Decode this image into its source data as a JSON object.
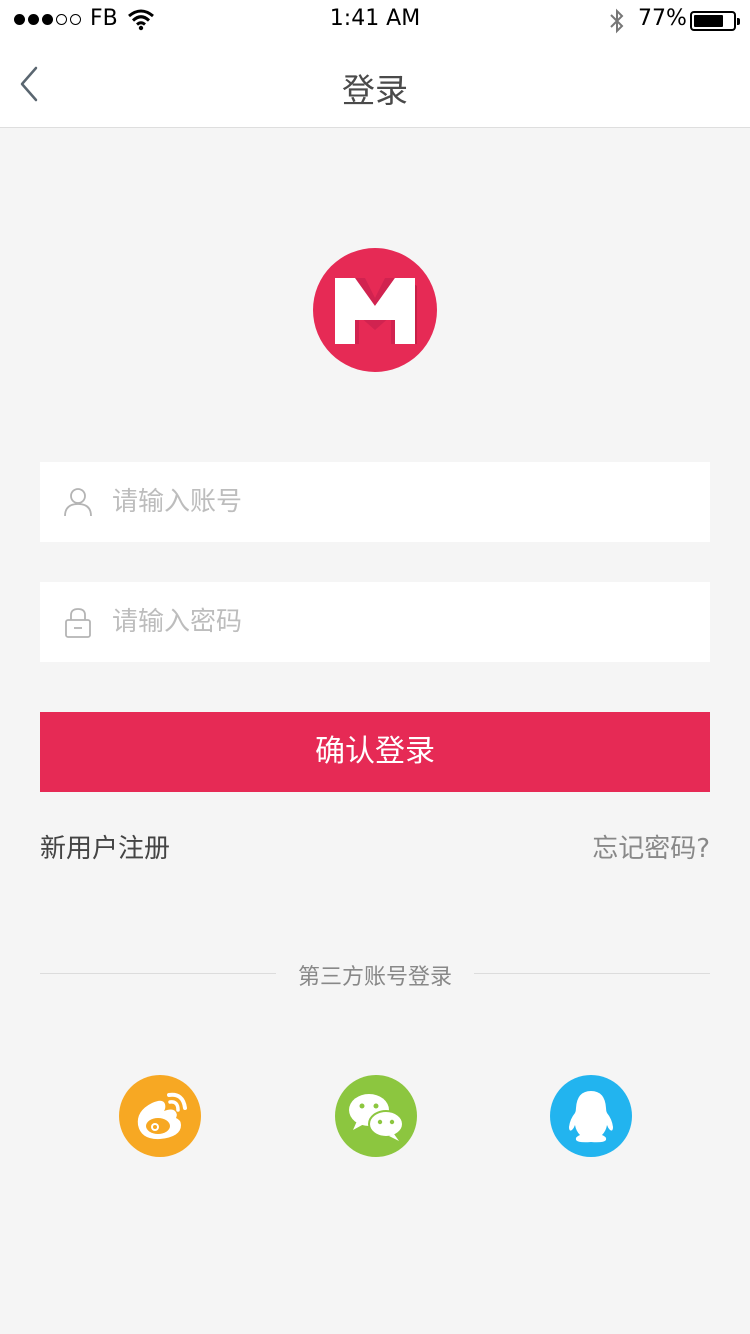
{
  "status_bar": {
    "carrier": "FB",
    "time": "1:41 AM",
    "battery_percent": "77%",
    "battery_level": 0.77,
    "signal_bars_filled": 3,
    "signal_bars_total": 5
  },
  "nav": {
    "title": "登录",
    "back_icon": "chevron-left-icon"
  },
  "logo": {
    "letter": "M",
    "color": "#e62a55"
  },
  "form": {
    "account": {
      "placeholder": "请输入账号",
      "value": "",
      "icon": "user-icon"
    },
    "password": {
      "placeholder": "请输入密码",
      "value": "",
      "icon": "lock-icon"
    },
    "submit_label": "确认登录",
    "submit_color": "#e62a55"
  },
  "links": {
    "register": "新用户注册",
    "forgot": "忘记密码?"
  },
  "third_party": {
    "title": "第三方账号登录",
    "providers": [
      {
        "name": "weibo",
        "icon": "weibo-icon",
        "color": "#f7a823"
      },
      {
        "name": "wechat",
        "icon": "wechat-icon",
        "color": "#8cc63f"
      },
      {
        "name": "qq",
        "icon": "qq-icon",
        "color": "#22b4ef"
      }
    ]
  }
}
